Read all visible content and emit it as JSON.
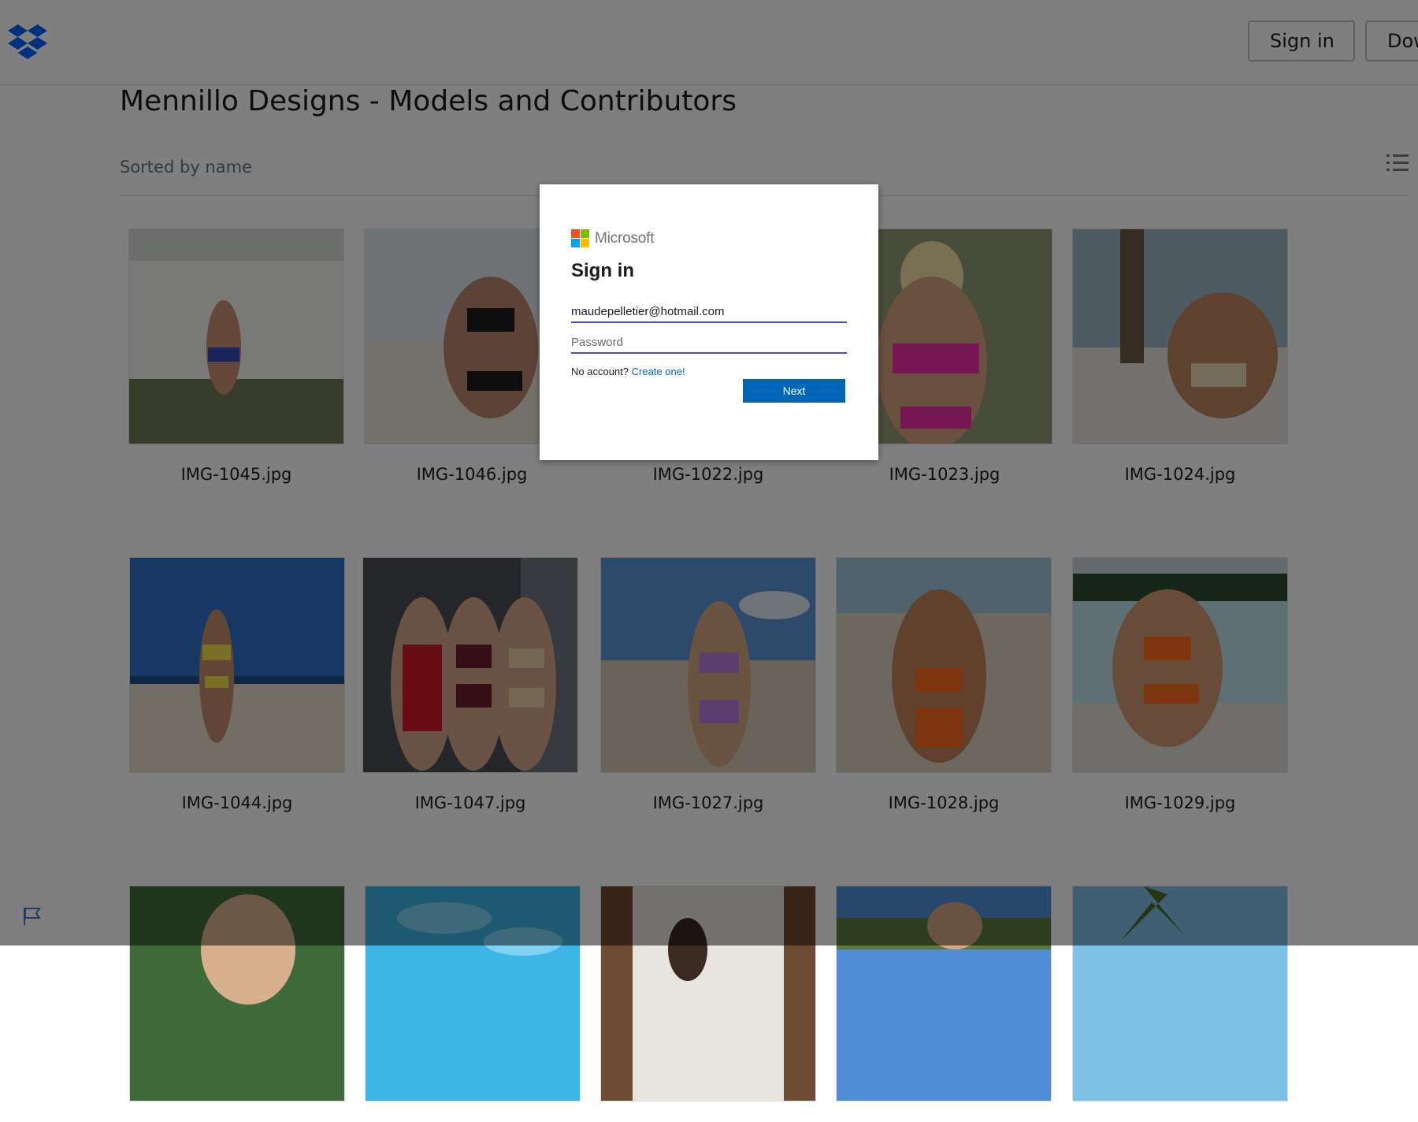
{
  "header": {
    "signin_label": "Sign in",
    "download_label": "Download"
  },
  "folder": {
    "title": "Mennillo Designs - Models and Contributors",
    "sort_label": "Sorted by name"
  },
  "files": [
    {
      "name": "IMG-1045.jpg"
    },
    {
      "name": "IMG-1046.jpg"
    },
    {
      "name": "IMG-1022.jpg"
    },
    {
      "name": "IMG-1023.jpg"
    },
    {
      "name": "IMG-1024.jpg"
    },
    {
      "name": "IMG-1044.jpg"
    },
    {
      "name": "IMG-1047.jpg"
    },
    {
      "name": "IMG-1027.jpg"
    },
    {
      "name": "IMG-1028.jpg"
    },
    {
      "name": "IMG-1029.jpg"
    },
    {
      "name": ""
    },
    {
      "name": ""
    },
    {
      "name": ""
    },
    {
      "name": ""
    },
    {
      "name": ""
    }
  ],
  "modal": {
    "brand": "Microsoft",
    "title": "Sign in",
    "email_value": "maudepelletier@hotmail.com",
    "password_placeholder": "Password",
    "no_account_text": "No account?",
    "create_link": "Create one!",
    "next_label": "Next"
  },
  "colors": {
    "dropbox_blue": "#0061fe",
    "ms_red": "#f25022",
    "ms_green": "#7fba00",
    "ms_blue": "#00a4ef",
    "ms_yellow": "#ffb900",
    "next_button": "#0067b8",
    "overlay": "rgba(0,0,0,0.5)"
  }
}
